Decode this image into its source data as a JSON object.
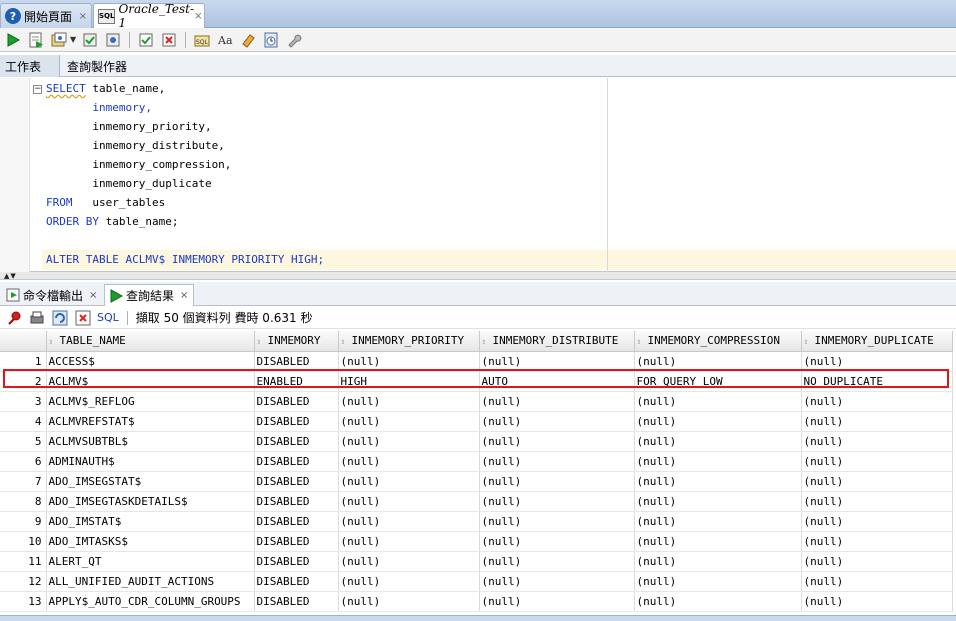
{
  "doc_tabs": [
    {
      "label": "開始頁面",
      "icon": "help-icon"
    },
    {
      "label": "Oracle_Test-1",
      "icon": "sql-worksheet-icon",
      "icon_text": "SQL"
    }
  ],
  "close_glyph": "×",
  "worksheet_tabs": [
    "工作表",
    "查詢製作器"
  ],
  "editor": {
    "lines": [
      {
        "kw": "SELECT",
        "rest": " table_name,"
      },
      {
        "kw": "",
        "rest": "       inmemory,"
      },
      {
        "kw": "",
        "rest": "       inmemory_priority,"
      },
      {
        "kw": "",
        "rest": "       inmemory_distribute,"
      },
      {
        "kw": "",
        "rest": "       inmemory_compression,"
      },
      {
        "kw": "",
        "rest": "       inmemory_duplicate"
      },
      {
        "kw": "FROM",
        "rest": "   user_tables"
      },
      {
        "kw": "ORDER BY",
        "rest": " table_name;"
      },
      {
        "kw": "",
        "rest": ""
      },
      {
        "kw": "ALTER TABLE ACLMV$ INMEMORY PRIORITY HIGH;",
        "rest": ""
      }
    ],
    "fold_glyph": "−"
  },
  "result_tabs": [
    {
      "label": "命令檔輸出",
      "icon": "script-output-icon"
    },
    {
      "label": "查詢結果",
      "icon": "run-icon"
    }
  ],
  "result_toolbar": {
    "sql_label": "SQL",
    "status": "擷取 50 個資料列 費時 0.631 秒"
  },
  "grid": {
    "columns": [
      "TABLE_NAME",
      "INMEMORY",
      "INMEMORY_PRIORITY",
      "INMEMORY_DISTRIBUTE",
      "INMEMORY_COMPRESSION",
      "INMEMORY_DUPLICATE"
    ],
    "rows": [
      [
        "1",
        "ACCESS$",
        "DISABLED",
        "(null)",
        "(null)",
        "(null)",
        "(null)"
      ],
      [
        "2",
        "ACLMV$",
        "ENABLED",
        "HIGH",
        "AUTO",
        "FOR QUERY LOW",
        "NO DUPLICATE"
      ],
      [
        "3",
        "ACLMV$_REFLOG",
        "DISABLED",
        "(null)",
        "(null)",
        "(null)",
        "(null)"
      ],
      [
        "4",
        "ACLMVREFSTAT$",
        "DISABLED",
        "(null)",
        "(null)",
        "(null)",
        "(null)"
      ],
      [
        "5",
        "ACLMVSUBTBL$",
        "DISABLED",
        "(null)",
        "(null)",
        "(null)",
        "(null)"
      ],
      [
        "6",
        "ADMINAUTH$",
        "DISABLED",
        "(null)",
        "(null)",
        "(null)",
        "(null)"
      ],
      [
        "7",
        "ADO_IMSEGSTAT$",
        "DISABLED",
        "(null)",
        "(null)",
        "(null)",
        "(null)"
      ],
      [
        "8",
        "ADO_IMSEGTASKDETAILS$",
        "DISABLED",
        "(null)",
        "(null)",
        "(null)",
        "(null)"
      ],
      [
        "9",
        "ADO_IMSTAT$",
        "DISABLED",
        "(null)",
        "(null)",
        "(null)",
        "(null)"
      ],
      [
        "10",
        "ADO_IMTASKS$",
        "DISABLED",
        "(null)",
        "(null)",
        "(null)",
        "(null)"
      ],
      [
        "11",
        "ALERT_QT",
        "DISABLED",
        "(null)",
        "(null)",
        "(null)",
        "(null)"
      ],
      [
        "12",
        "ALL_UNIFIED_AUDIT_ACTIONS",
        "DISABLED",
        "(null)",
        "(null)",
        "(null)",
        "(null)"
      ],
      [
        "13",
        "APPLY$_AUTO_CDR_COLUMN_GROUPS",
        "DISABLED",
        "(null)",
        "(null)",
        "(null)",
        "(null)"
      ]
    ],
    "highlighted_row_index": 1
  },
  "colors": {
    "keyword": "#1a39c9",
    "highlight_border": "#e0161b",
    "current_line": "#fdf7df"
  }
}
